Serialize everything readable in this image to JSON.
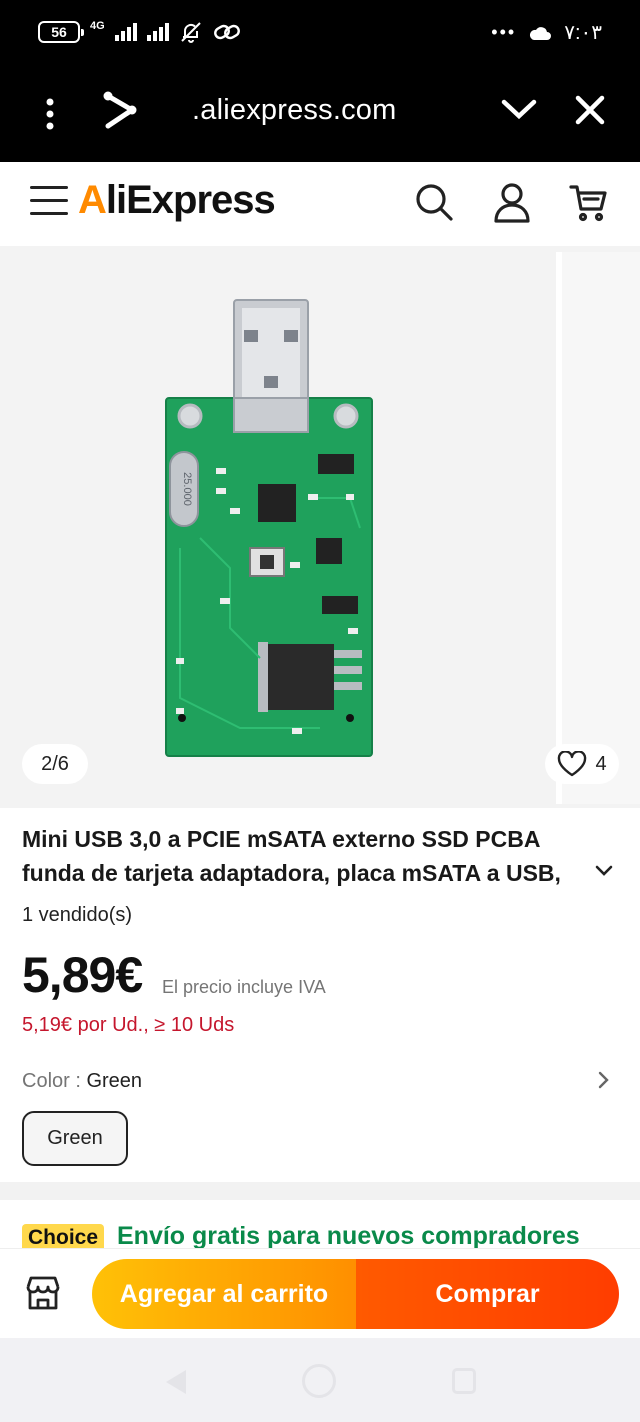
{
  "status_bar": {
    "battery": "56",
    "network": "4G",
    "time": "٧:٠٣",
    "icons": [
      "battery-icon",
      "signal-icon",
      "mute-bell-icon",
      "link-icon",
      "more-dots-icon",
      "cloud-icon"
    ]
  },
  "browser": {
    "url": ".aliexpress.com",
    "icons": [
      "menu-dots-icon",
      "share-icon",
      "chevron-down-icon",
      "close-icon"
    ]
  },
  "app_header": {
    "logo_prefix": "A",
    "logo_rest": "liExpress",
    "icons": [
      "hamburger-icon",
      "search-icon",
      "user-icon",
      "cart-icon"
    ]
  },
  "gallery": {
    "counter": "2/6",
    "favorites": "4",
    "pcb_label": "25.000"
  },
  "product": {
    "title": "Mini USB 3,0 a PCIE mSATA externo SSD PCBA funda de tarjeta adaptadora, placa mSATA a USB,",
    "sold": "1 vendido(s)",
    "price": "5,89€",
    "vat_note": "El precio incluye IVA",
    "bulk_price": "5,19€ por Ud., ≥ 10 Uds",
    "color_label": "Color : ",
    "color_value": "Green",
    "color_option": "Green"
  },
  "choice": {
    "badge": "Choice",
    "text": "Envío gratis para nuevos compradores"
  },
  "actions": {
    "add_to_cart": "Agregar al carrito",
    "buy": "Comprar"
  },
  "colors": {
    "accent_orange": "#ff8f00",
    "buy_red": "#ff3d00",
    "price_red": "#c5162d",
    "choice_green": "#0a8a4a",
    "choice_yellow": "#ffd84c",
    "pcb_green": "#1fa15c"
  }
}
